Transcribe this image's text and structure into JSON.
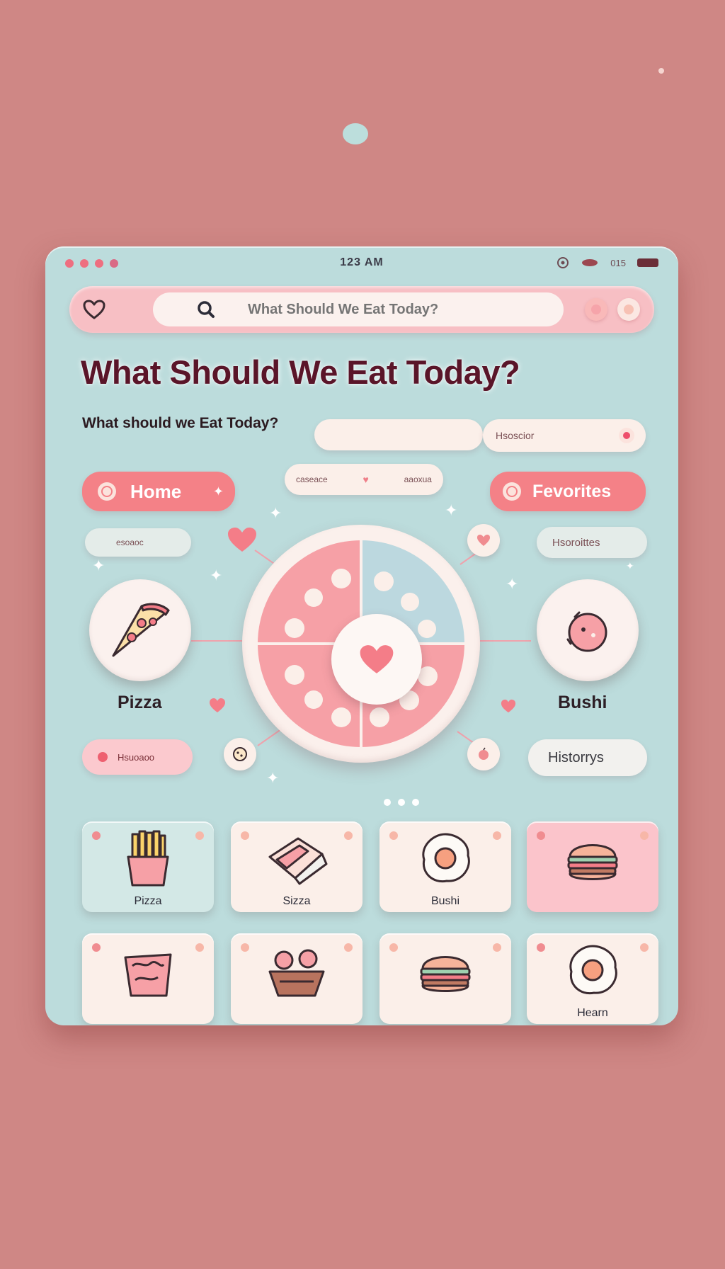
{
  "status": {
    "time": "123 AM",
    "battery_text": "015"
  },
  "search": {
    "placeholder": "What Should We Eat Today?",
    "value": "What Should We Eat Today?"
  },
  "header": {
    "title": "What Should We Eat Today?",
    "subtitle": "What should we Eat Today?"
  },
  "pills": {
    "history_small": "Hsoscior",
    "home": "Home",
    "center_left": "caseace",
    "center_right": "aaoxua",
    "favorites": "Fevorites",
    "left_small": "esoaoc",
    "favorites_small": "Hsoroittes",
    "history_left": "Hsuoaoo",
    "histories": "Historrys"
  },
  "foods": {
    "left": "Pizza",
    "right": "Bushi"
  },
  "tiles": [
    {
      "label": "Pizza",
      "icon": "fries-icon",
      "style": "mint"
    },
    {
      "label": "Sizza",
      "icon": "wrap-icon",
      "style": "cream"
    },
    {
      "label": "Bushi",
      "icon": "egg-icon",
      "style": "cream"
    },
    {
      "label": "",
      "icon": "burger-icon",
      "style": "pink"
    },
    {
      "label": "",
      "icon": "salad-bowl-icon",
      "style": "cream"
    },
    {
      "label": "",
      "icon": "basket-icon",
      "style": "cream"
    },
    {
      "label": "",
      "icon": "burger-icon",
      "style": "cream"
    },
    {
      "label": "Hearn",
      "icon": "egg-icon",
      "style": "cream"
    }
  ],
  "colors": {
    "background": "#cf8785",
    "panel": "#bcdcdc",
    "accent_pink": "#f48187",
    "cream": "#fbefe9",
    "title": "#5a1529"
  }
}
